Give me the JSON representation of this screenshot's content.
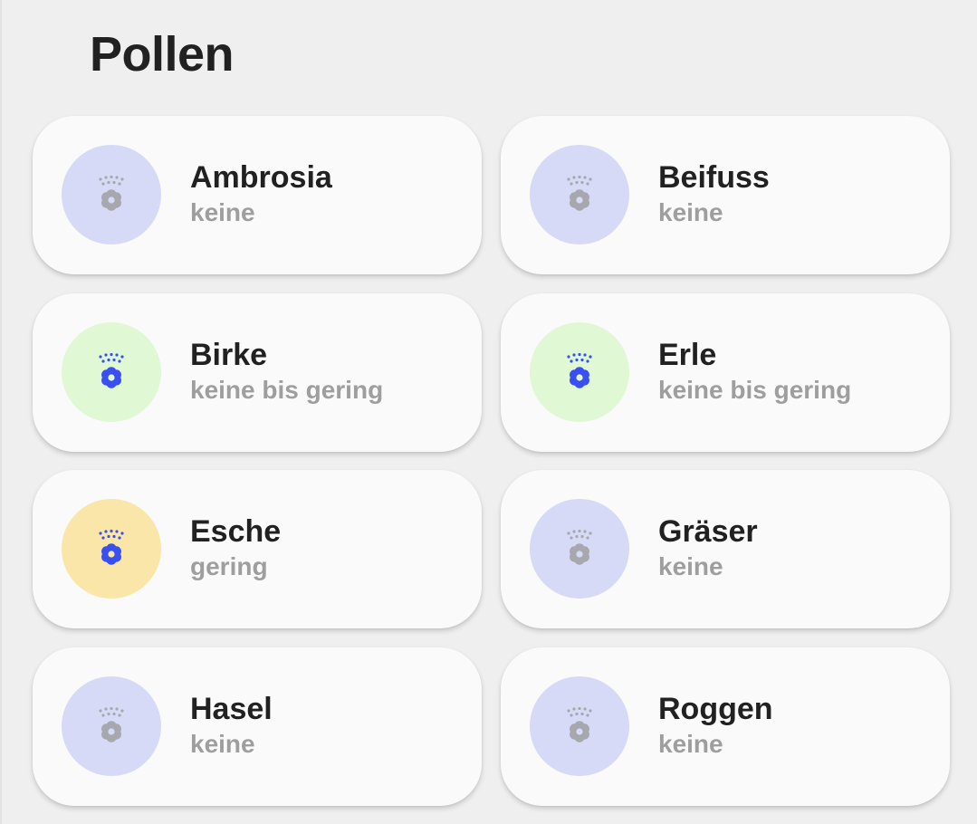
{
  "page": {
    "title": "Pollen"
  },
  "colors": {
    "level_none_bg": "#d6daf7",
    "level_low_bg": "#e0f8d4",
    "level_mid_bg": "#f9e6a8",
    "icon_inactive": "#a6a8ad",
    "icon_active": "#3a4ff2"
  },
  "pollen": [
    {
      "name": "Ambrosia",
      "level": "keine",
      "severity": "none",
      "icon": "pollen-flower-icon"
    },
    {
      "name": "Beifuss",
      "level": "keine",
      "severity": "none",
      "icon": "pollen-flower-icon"
    },
    {
      "name": "Birke",
      "level": "keine bis gering",
      "severity": "low",
      "icon": "pollen-flower-icon"
    },
    {
      "name": "Erle",
      "level": "keine bis gering",
      "severity": "low",
      "icon": "pollen-flower-icon"
    },
    {
      "name": "Esche",
      "level": "gering",
      "severity": "mid",
      "icon": "pollen-flower-icon"
    },
    {
      "name": "Gräser",
      "level": "keine",
      "severity": "none",
      "icon": "pollen-flower-icon"
    },
    {
      "name": "Hasel",
      "level": "keine",
      "severity": "none",
      "icon": "pollen-flower-icon"
    },
    {
      "name": "Roggen",
      "level": "keine",
      "severity": "none",
      "icon": "pollen-flower-icon"
    }
  ]
}
